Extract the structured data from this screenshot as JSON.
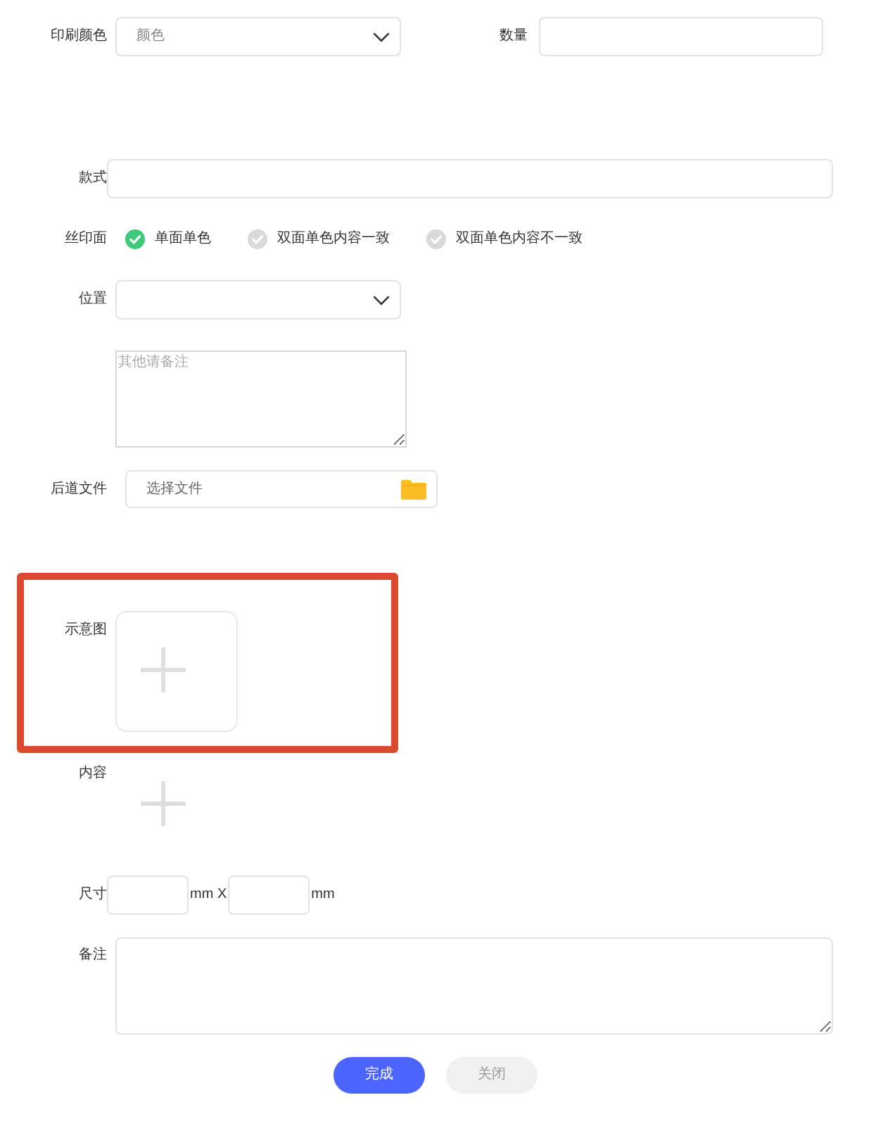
{
  "form": {
    "rows": [
      {
        "kind": "pair",
        "fields": [
          {
            "kind": "select",
            "label": "印刷颜色",
            "placeholder": "颜色"
          },
          {
            "kind": "input",
            "label": "数量"
          }
        ]
      },
      {
        "kind": "input",
        "label": "款式"
      },
      {
        "kind": "radios",
        "label": "丝印面",
        "options": [
          {
            "label": "单面单色",
            "selected": true
          },
          {
            "label": "双面单色内容一致",
            "selected": false
          },
          {
            "label": "双面单色内容不一致",
            "selected": false
          }
        ]
      },
      {
        "kind": "select",
        "label": "位置"
      },
      {
        "kind": "textarea",
        "placeholder": "其他请备注"
      },
      {
        "kind": "file",
        "label": "后道文件",
        "placeholder": "选择文件"
      },
      {
        "kind": "upload",
        "label": "示意图",
        "highlighted": true
      },
      {
        "kind": "add",
        "label": "内容"
      },
      {
        "kind": "size",
        "label": "尺寸",
        "separator": "mm X",
        "unit": "mm"
      },
      {
        "kind": "textarea",
        "label": "备注"
      }
    ],
    "buttons": [
      {
        "label": "完成",
        "kind": "primary"
      },
      {
        "label": "关闭",
        "kind": "secondary"
      }
    ]
  }
}
